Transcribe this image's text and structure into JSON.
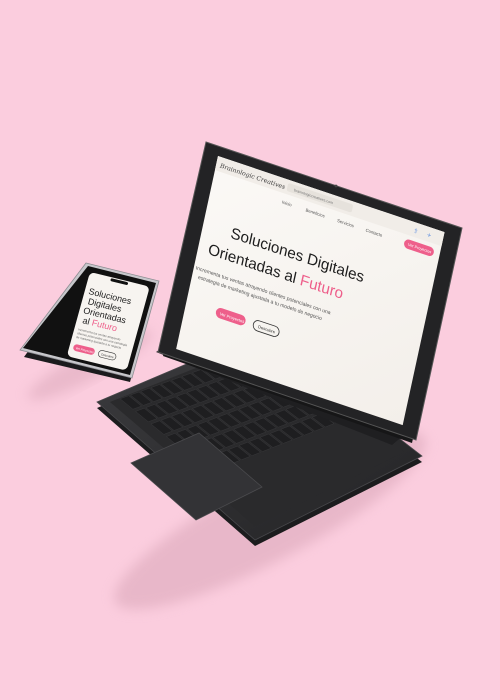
{
  "tablet": {
    "brand": "Brainnlogic Creatives",
    "url": "brainnlogiccreatives.com",
    "nav": [
      "Inicio",
      "Beneficios",
      "Servicios",
      "Contacto"
    ],
    "cta_top": "Ver Proyectos",
    "hero_line1": "Soluciones Digitales",
    "hero_line2_prefix": "Orientadas al ",
    "hero_highlight": "Futuro",
    "sub_line1": "Incrementa tus ventas atrayendo clientes potenciales con una",
    "sub_line2": "estrategia de marketing ajustada a tu modelo de negocio",
    "btn_primary": "Ver Proyectos",
    "btn_secondary": "Descubre"
  },
  "phone": {
    "hero_line1": "Soluciones",
    "hero_line2": "Digitales",
    "hero_line3": "Orientadas",
    "hero_line4_prefix": "al ",
    "hero_highlight": "Futuro",
    "sub_line1": "Incrementa tus ventas atrayendo",
    "sub_line2": "clientes potenciales con una estrategia",
    "sub_line3": "de marketing ajustada a tu negocio",
    "btn_primary": "Ver Proyectos",
    "btn_secondary": "Descubre"
  },
  "colors": {
    "background": "#fbcdde",
    "accent": "#ee5f8b",
    "screen": "#f8f5f1",
    "device": "#2b2b2d"
  }
}
